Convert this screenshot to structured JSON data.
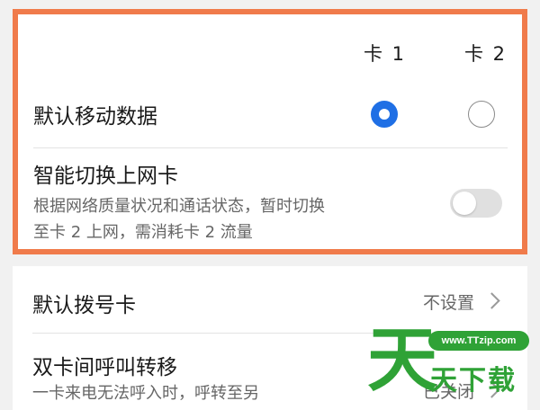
{
  "sim_settings": {
    "col_card1": "卡 1",
    "col_card2": "卡 2",
    "default_data": {
      "label": "默认移动数据",
      "card1_selected": true,
      "card2_selected": false
    },
    "smart_switch": {
      "label": "智能切换上网卡",
      "desc_line1": "根据网络质量状况和通话状态，暂时切换",
      "desc_line2": "至卡 2 上网，需消耗卡 2 流量",
      "enabled": false
    }
  },
  "call_settings": {
    "default_dial": {
      "label": "默认拨号卡",
      "value": "不设置"
    },
    "call_forward": {
      "label": "双卡间呼叫转移",
      "desc": "一卡来电无法呼入时，呼转至另",
      "value": "已关闭"
    }
  },
  "watermark": {
    "url": "www.TTzip.com",
    "big_char": "天",
    "text": "天下载"
  },
  "colors": {
    "highlight_border": "#f07b4b",
    "radio_selected": "#1f6fe5",
    "watermark_green": "#2fa236"
  }
}
